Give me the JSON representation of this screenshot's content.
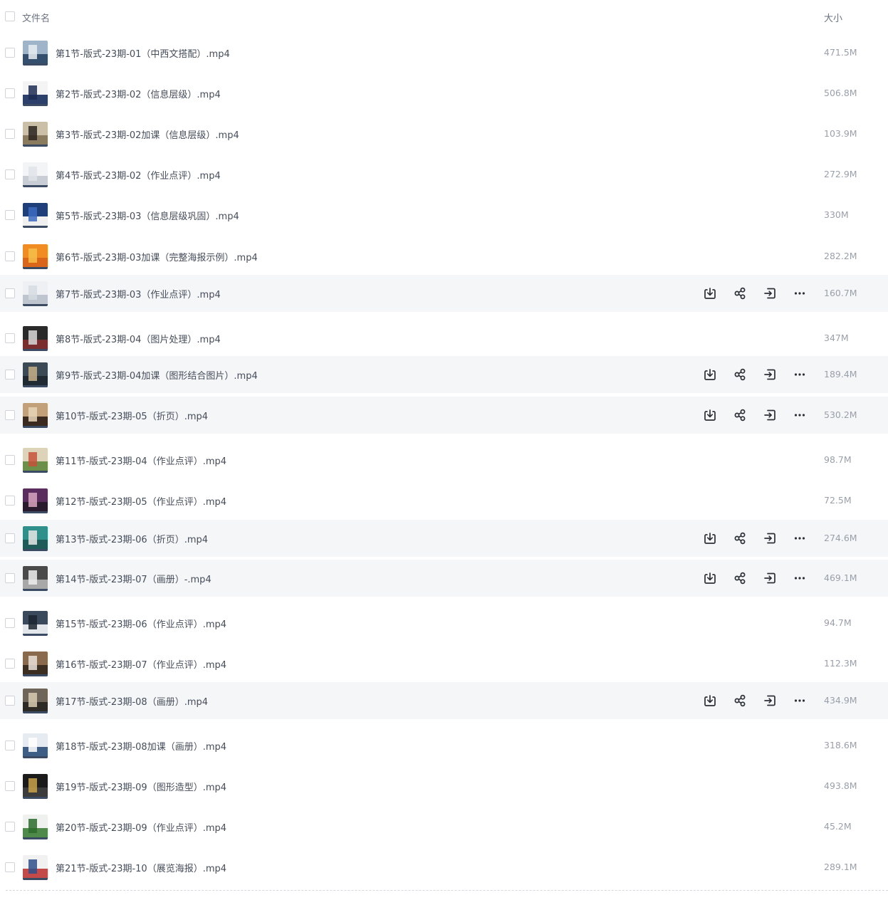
{
  "header": {
    "name_label": "文件名",
    "size_label": "大小"
  },
  "icons": {
    "download": "download-icon",
    "share": "share-icon",
    "move": "move-to-icon",
    "more": "more-icon"
  },
  "files": [
    {
      "name": "第1节-版式-23期-01（中西文搭配）.mp4",
      "size": "471.5M",
      "hover": false,
      "thumb": {
        "a": "#9fb4c9",
        "b": "#35506f",
        "block": "#e8edf2"
      }
    },
    {
      "name": "第2节-版式-23期-02（信息层级）.mp4",
      "size": "506.8M",
      "hover": false,
      "thumb": {
        "a": "#f4f4f4",
        "b": "#2d3f6b",
        "block": "#1d2b52"
      }
    },
    {
      "name": "第3节-版式-23期-02加课（信息层级）.mp4",
      "size": "103.9M",
      "hover": false,
      "thumb": {
        "a": "#cbbfa8",
        "b": "#8a7a5e",
        "block": "#2b2420"
      }
    },
    {
      "name": "第4节-版式-23期-02（作业点评）.mp4",
      "size": "272.9M",
      "hover": false,
      "thumb": {
        "a": "#f3f4f6",
        "b": "#c9ced6",
        "block": "#dfe3e8"
      }
    },
    {
      "name": "第5节-版式-23期-03（信息层级巩固）.mp4",
      "size": "330M",
      "hover": false,
      "thumb": {
        "a": "#1f3f7a",
        "b": "#f0f0f0",
        "block": "#3c6bc0"
      }
    },
    {
      "name": "第6节-版式-23期-03加课（完整海报示例）.mp4",
      "size": "282.2M",
      "hover": false,
      "thumb": {
        "a": "#f08c22",
        "b": "#d9661a",
        "block": "#f6c04a"
      }
    },
    {
      "name": "第7节-版式-23期-03（作业点评）.mp4",
      "size": "160.7M",
      "hover": true,
      "thumb": {
        "a": "#eef0f3",
        "b": "#bfc5ce",
        "block": "#d6dbe2"
      }
    },
    {
      "name": "第8节-版式-23期-04（图片处理）.mp4",
      "size": "347M",
      "hover": false,
      "thumb": {
        "a": "#2a2a2a",
        "b": "#7a2e2e",
        "block": "#d9d9d9"
      }
    },
    {
      "name": "第9节-版式-23期-04加课（图形结合图片）.mp4",
      "size": "189.4M",
      "hover": true,
      "thumb": {
        "a": "#3b4a55",
        "b": "#1f2a33",
        "block": "#c8b08a"
      }
    },
    {
      "name": "第10节-版式-23期-05（折页）.mp4",
      "size": "530.2M",
      "hover": true,
      "thumb": {
        "a": "#c2a07a",
        "b": "#3a2a20",
        "block": "#e8d6b8"
      }
    },
    {
      "name": "第11节-版式-23期-04（作业点评）.mp4",
      "size": "98.7M",
      "hover": false,
      "thumb": {
        "a": "#dcd3b8",
        "b": "#6c8f4a",
        "block": "#c5523a"
      }
    },
    {
      "name": "第12节-版式-23期-05（作业点评）.mp4",
      "size": "72.5M",
      "hover": false,
      "thumb": {
        "a": "#5a2d5e",
        "b": "#2a1a2e",
        "block": "#d9a4c0"
      }
    },
    {
      "name": "第13节-版式-23期-06（折页）.mp4",
      "size": "274.6M",
      "hover": true,
      "thumb": {
        "a": "#2f8f8a",
        "b": "#1f5c59",
        "block": "#e6e6e6"
      }
    },
    {
      "name": "第14节-版式-23期-07（画册）-.mp4",
      "size": "469.1M",
      "hover": true,
      "thumb": {
        "a": "#4a4a4a",
        "b": "#a8a8a8",
        "block": "#efefef"
      }
    },
    {
      "name": "第15节-版式-23期-06（作业点评）.mp4",
      "size": "94.7M",
      "hover": false,
      "thumb": {
        "a": "#3a4a5c",
        "b": "#e3e6ea",
        "block": "#1c2530"
      }
    },
    {
      "name": "第16节-版式-23期-07（作业点评）.mp4",
      "size": "112.3M",
      "hover": false,
      "thumb": {
        "a": "#8a6a4c",
        "b": "#3d2e22",
        "block": "#e9e2d8"
      }
    },
    {
      "name": "第17节-版式-23期-08（画册）.mp4",
      "size": "434.9M",
      "hover": true,
      "thumb": {
        "a": "#6f6558",
        "b": "#2e2a26",
        "block": "#d8cbb3"
      }
    },
    {
      "name": "第18节-版式-23期-08加课（画册）.mp4",
      "size": "318.6M",
      "hover": false,
      "thumb": {
        "a": "#e6ebf2",
        "b": "#3f5e86",
        "block": "#ffffff"
      }
    },
    {
      "name": "第19节-版式-23期-09（图形造型）.mp4",
      "size": "493.8M",
      "hover": false,
      "thumb": {
        "a": "#1b1b1b",
        "b": "#3c3c3c",
        "block": "#c9a24a"
      }
    },
    {
      "name": "第20节-版式-23期-09（作业点评）.mp4",
      "size": "45.2M",
      "hover": false,
      "thumb": {
        "a": "#eef1ee",
        "b": "#4f8a4a",
        "block": "#2c6b2a"
      }
    },
    {
      "name": "第21节-版式-23期-10（展览海报）.mp4",
      "size": "289.1M",
      "hover": false,
      "thumb": {
        "a": "#f1f1f1",
        "b": "#c44a4a",
        "block": "#2f4f8a"
      }
    }
  ]
}
